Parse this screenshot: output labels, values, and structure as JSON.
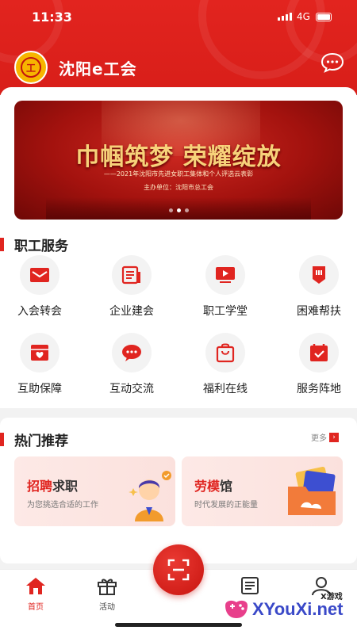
{
  "status": {
    "time": "11:33",
    "network": "4G"
  },
  "header": {
    "app_title": "沈阳e工会",
    "logo_glyph": "工"
  },
  "banner": {
    "headline": "巾帼筑梦 荣耀绽放",
    "subtitle": "——2021年沈阳市先进女职工集体和个人评选云表彰",
    "host": "主办单位：沈阳市总工会",
    "slide_count": 3,
    "active_slide": 2
  },
  "services": {
    "title": "职工服务",
    "items": [
      {
        "label": "入会转会",
        "icon": "envelope-icon"
      },
      {
        "label": "企业建会",
        "icon": "document-icon"
      },
      {
        "label": "职工学堂",
        "icon": "video-play-icon"
      },
      {
        "label": "困难帮扶",
        "icon": "badge-icon"
      },
      {
        "label": "互助保障",
        "icon": "heart-shield-icon"
      },
      {
        "label": "互动交流",
        "icon": "chat-bubble-icon"
      },
      {
        "label": "福利在线",
        "icon": "shopping-bag-icon"
      },
      {
        "label": "服务阵地",
        "icon": "calendar-check-icon"
      }
    ]
  },
  "hot": {
    "title": "热门推荐",
    "more": "更多",
    "cards": [
      {
        "title_red": "招聘",
        "title_rest": "求职",
        "desc": "为您挑选合适的工作"
      },
      {
        "title_red": "劳模",
        "title_rest": "馆",
        "desc": "时代发展的正能量"
      }
    ]
  },
  "tabbar": {
    "items": [
      {
        "label": "首页",
        "icon": "home-icon",
        "active": true
      },
      {
        "label": "活动",
        "icon": "gift-icon",
        "active": false
      },
      {
        "label": "",
        "icon": "news-icon",
        "active": false
      },
      {
        "label": "",
        "icon": "user-icon",
        "active": false
      }
    ]
  },
  "watermark": {
    "text": "XYouXi.net",
    "small": "X游戏"
  },
  "colors": {
    "primary": "#e02520",
    "header": "#d81e19",
    "gold": "#f7b500"
  }
}
